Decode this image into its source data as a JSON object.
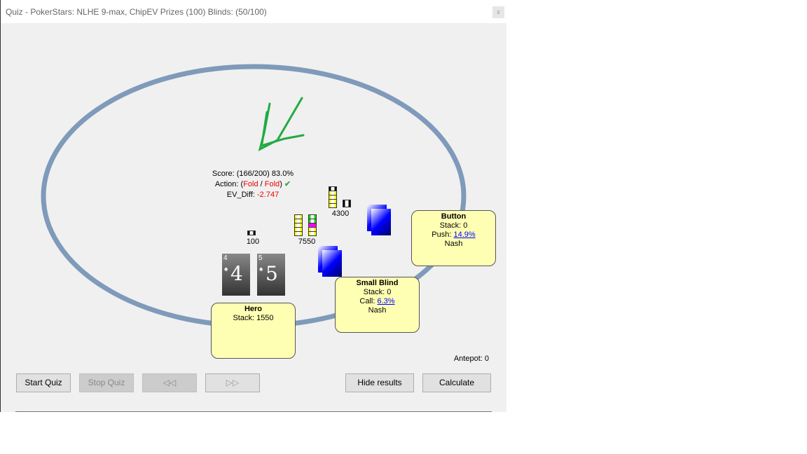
{
  "window": {
    "title": "Quiz - PokerStars: NLHE 9-max, ChipEV Prizes (100) Blinds: (50/100)",
    "close_label": "x"
  },
  "result": {
    "score": "Score: (166/200) 83.0%",
    "action_prefix": "Action: (",
    "action_1": "Fold",
    "action_sep": " / ",
    "action_2": "Fold",
    "action_suffix": ")",
    "ev_label": "EV_Diff: ",
    "ev_value": "-2.747"
  },
  "pots": {
    "hero_bet": "100",
    "pot": "7550",
    "button_bet": "4300",
    "antepot": "Antepot: 0"
  },
  "hero": {
    "name": "Hero",
    "stack": "Stack: 1550",
    "cards": [
      {
        "rank": "4",
        "suit": "♠"
      },
      {
        "rank": "5",
        "suit": "♠"
      }
    ]
  },
  "small_blind": {
    "name": "Small Blind",
    "stack": "Stack: 0",
    "action": "Call: ",
    "pct": "6.3%",
    "strategy": "Nash"
  },
  "button": {
    "name": "Button",
    "stack": "Stack: 0",
    "action": "Push: ",
    "pct": "14.9%",
    "strategy": "Nash"
  },
  "buttons": {
    "start": "Start Quiz",
    "stop": "Stop Quiz",
    "prev": "◁◁",
    "next": "▷▷",
    "hide": "Hide results",
    "calc": "Calculate"
  },
  "colors": {
    "table_rail": "#7f9aba",
    "seat_box": "#ffffb4",
    "check": "#22aa44"
  }
}
